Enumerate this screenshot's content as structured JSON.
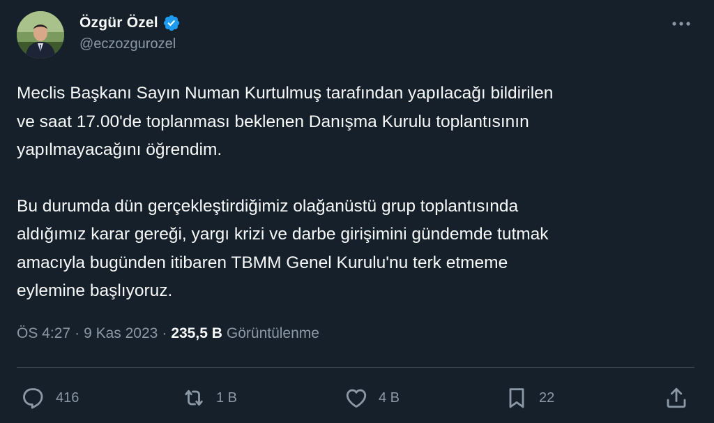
{
  "author": {
    "display_name": "Özgür Özel",
    "handle": "@eczozgurozel",
    "verified": true,
    "verified_color": "#1d9bf0"
  },
  "tweet": {
    "paragraphs": [
      "Meclis Başkanı Sayın Numan Kurtulmuş tarafından yapılacağı bildirilen\nve saat 17.00'de toplanması beklenen Danışma Kurulu toplantısının\nyapılmayacağını öğrendim.",
      "Bu durumda dün gerçekleştirdiğimiz olağanüstü grup toplantısında\naldığımız karar gereği, yargı krizi ve darbe girişimini gündemde tutmak\namacıyla bugünden itibaren TBMM Genel Kurulu'nu terk etmeme\neylemine başlıyoruz."
    ]
  },
  "meta": {
    "time": "ÖS 4:27",
    "separator": "·",
    "date": "9 Kas 2023",
    "views_count": "235,5 B",
    "views_label": "Görüntülenme"
  },
  "actions": {
    "reply": {
      "icon": "reply-icon",
      "count": "416"
    },
    "retweet": {
      "icon": "retweet-icon",
      "count": "1 B"
    },
    "like": {
      "icon": "heart-icon",
      "count": "4 B"
    },
    "bookmark": {
      "icon": "bookmark-icon",
      "count": "22"
    },
    "share": {
      "icon": "share-icon"
    }
  },
  "colors": {
    "background": "#15202b",
    "primary_text": "#f7f9f9",
    "secondary_text": "#8b98a5",
    "divider": "#38444d"
  }
}
